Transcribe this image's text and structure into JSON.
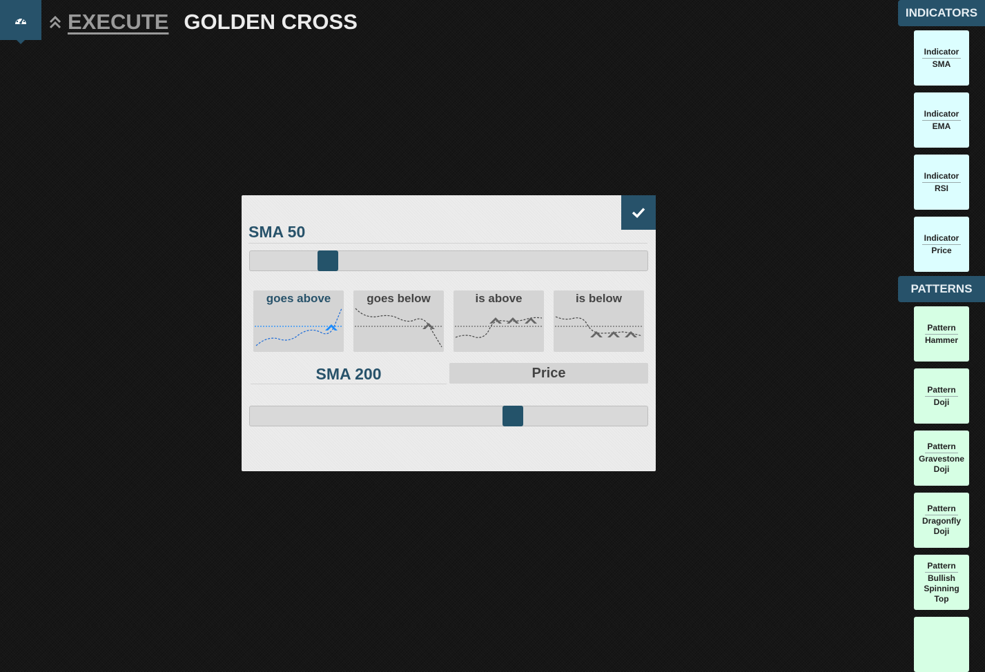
{
  "header": {
    "dashboard_icon": "dashboard-gauge-icon",
    "collapse_icon": "double-chevron-up-icon",
    "execute_label": "EXECUTE",
    "strategy_name": "GOLDEN CROSS"
  },
  "sidebar": {
    "indicators_header": "INDICATORS",
    "indicators": [
      {
        "kind": "Indicator",
        "name": "SMA"
      },
      {
        "kind": "Indicator",
        "name": "EMA"
      },
      {
        "kind": "Indicator",
        "name": "RSI"
      },
      {
        "kind": "Indicator",
        "name": "Price"
      }
    ],
    "patterns_header": "PATTERNS",
    "patterns": [
      {
        "kind": "Pattern",
        "name": "Hammer"
      },
      {
        "kind": "Pattern",
        "name": "Doji"
      },
      {
        "kind": "Pattern",
        "name": "Gravestone Doji"
      },
      {
        "kind": "Pattern",
        "name": "Dragonfly Doji"
      },
      {
        "kind": "Pattern",
        "name": "Bullish Spinning Top"
      },
      {
        "kind": "Pattern",
        "name": ""
      }
    ]
  },
  "panel": {
    "confirm_icon": "check-icon",
    "indicator_title": "SMA 50",
    "period_slider_level": 0.18,
    "conditions": [
      {
        "label": "goes above",
        "active": true
      },
      {
        "label": "goes below",
        "active": false
      },
      {
        "label": "is above",
        "active": false
      },
      {
        "label": "is below",
        "active": false
      }
    ],
    "target_selected": "SMA 200",
    "target_other": "Price",
    "target_slider_level": 0.67
  },
  "colors": {
    "accent": "#27526a",
    "indicator_tile": "#dcfeff",
    "pattern_tile": "#d6ffe4",
    "panel_bg": "#ececec",
    "active_marker": "#1a8cff"
  }
}
